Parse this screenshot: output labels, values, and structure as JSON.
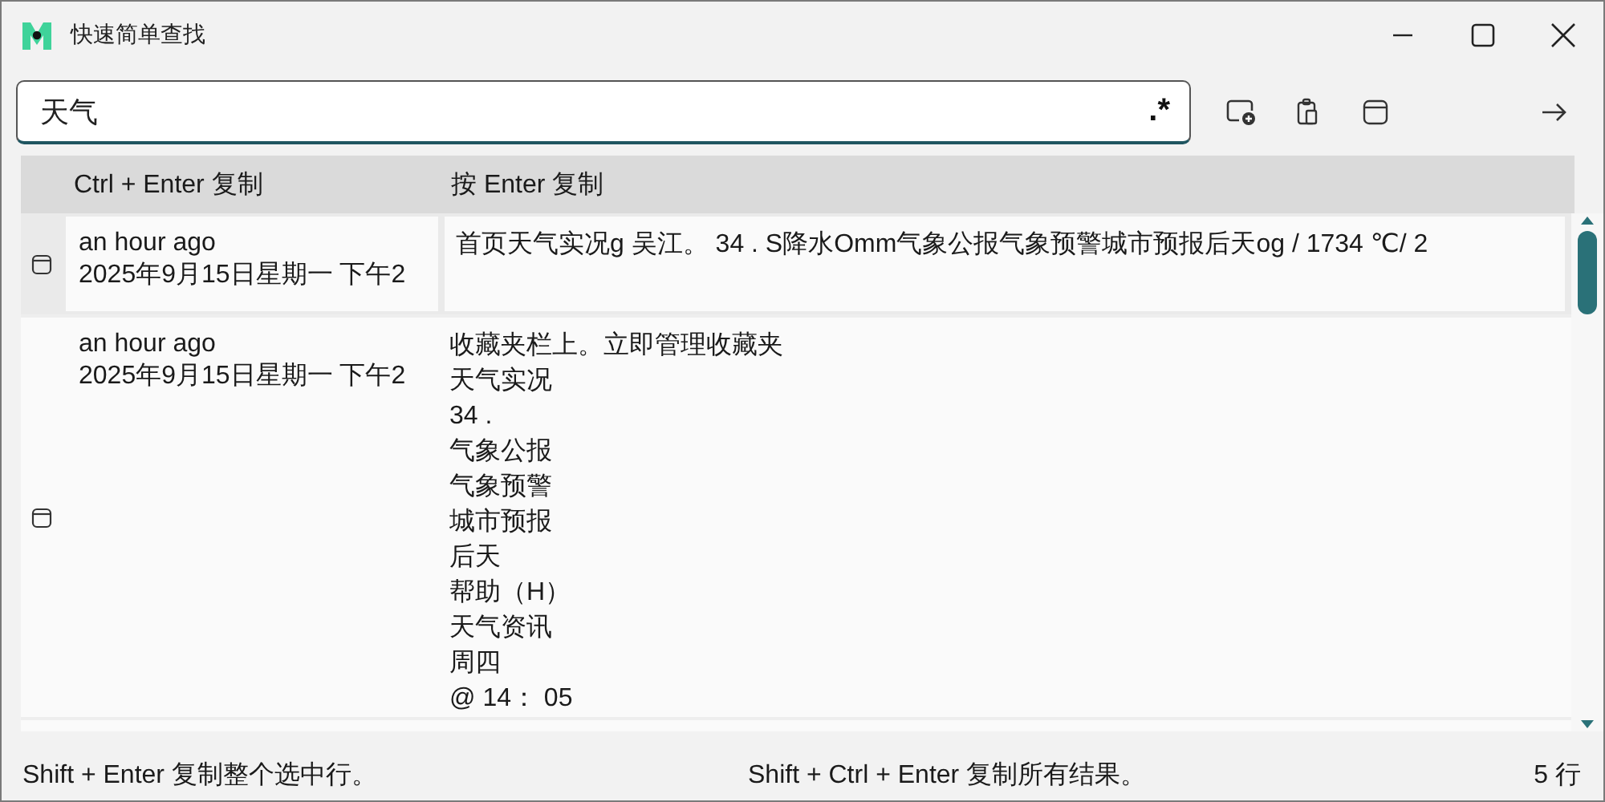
{
  "window": {
    "title": "快速简单查找"
  },
  "search": {
    "value": "天气",
    "regex_label": ".*"
  },
  "table": {
    "columns": [
      "Ctrl + Enter 复制",
      "按 Enter 复制"
    ],
    "rows": [
      {
        "selected": true,
        "time": "an hour ago",
        "date": "2025年9月15日星期一 下午2",
        "lines": [
          "首页天气实况g 吴江。 34 .  S降水Omm气象公报气象预警城市预报后天og / 1734 ℃/ 2"
        ]
      },
      {
        "selected": false,
        "time": "an hour ago",
        "date": "2025年9月15日星期一 下午2",
        "lines": [
          "收藏夹栏上。立即管理收藏夹",
          "天气实况",
          "34 .",
          "气象公报",
          "气象预警",
          "城市预报",
          "后天",
          "帮助（H）",
          "天气资讯",
          "周四",
          "@ 14： 05"
        ]
      }
    ]
  },
  "status_bar": {
    "left": "Shift + Enter 复制整个选中行。",
    "center": "Shift + Ctrl + Enter 复制所有结果。",
    "right": "5 行"
  }
}
